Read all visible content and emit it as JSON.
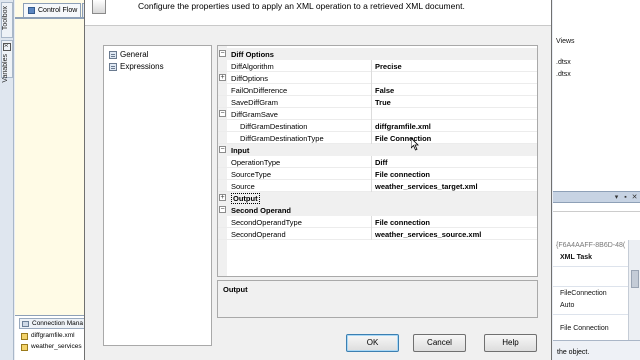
{
  "ide": {
    "left_tabs": [
      "Toolbox",
      "Variables"
    ],
    "active_tab": "Control Flow",
    "connection_managers": {
      "title": "Connection Mana",
      "items": [
        "diffgramfile.xml",
        "weather_services"
      ]
    },
    "solution_fragments": [
      "Views",
      ".dtsx",
      ".dtsx"
    ],
    "properties": {
      "selected_object": "{F6A4AAFF-8B6D-48(",
      "object_name": "XML Task",
      "rows": [
        "FileConnection",
        "Auto",
        "File Connection"
      ],
      "description": "the object."
    }
  },
  "dialog": {
    "header_text": "Configure the properties used to apply an XML operation to a retrieved XML document.",
    "nav": [
      {
        "label": "General"
      },
      {
        "label": "Expressions"
      }
    ],
    "grid": {
      "rows": [
        {
          "kind": "category",
          "name": "Diff Options",
          "toggle": "⊟"
        },
        {
          "kind": "data",
          "name": "DiffAlgorithm",
          "value": "Precise"
        },
        {
          "kind": "expander",
          "name": "DiffOptions",
          "toggle": "⊞"
        },
        {
          "kind": "data",
          "name": "FailOnDifference",
          "value": "False"
        },
        {
          "kind": "data",
          "name": "SaveDiffGram",
          "value": "True"
        },
        {
          "kind": "expander",
          "name": "DiffGramSave",
          "toggle": "⊟"
        },
        {
          "kind": "data-indent",
          "name": "DiffGramDestination",
          "value": "diffgramfile.xml"
        },
        {
          "kind": "data-indent",
          "name": "DiffGramDestinationType",
          "value": "File Connection"
        },
        {
          "kind": "category",
          "name": "Input",
          "toggle": "⊟"
        },
        {
          "kind": "data",
          "name": "OperationType",
          "value": "Diff"
        },
        {
          "kind": "data",
          "name": "SourceType",
          "value": "File connection"
        },
        {
          "kind": "data",
          "name": "Source",
          "value": "weather_services_target.xml"
        },
        {
          "kind": "category-selected",
          "name": "Output",
          "toggle": "⊞"
        },
        {
          "kind": "category",
          "name": "Second Operand",
          "toggle": "⊟"
        },
        {
          "kind": "data",
          "name": "SecondOperandType",
          "value": "File connection"
        },
        {
          "kind": "data",
          "name": "SecondOperand",
          "value": "weather_services_source.xml"
        }
      ]
    },
    "description_title": "Output",
    "buttons": {
      "ok": "OK",
      "cancel": "Cancel",
      "help": "Help"
    }
  }
}
